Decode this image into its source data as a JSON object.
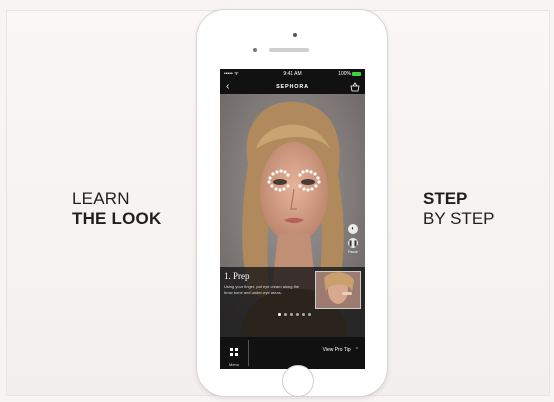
{
  "left_caption": {
    "line1": "LEARN",
    "line2": "THE LOOK"
  },
  "right_caption": {
    "line1": "STEP",
    "line2": "BY STEP"
  },
  "status_bar": {
    "carrier": "•••••  ᯤ",
    "time": "9:41 AM",
    "battery": "100%"
  },
  "nav": {
    "back_icon": "chevron-left-icon",
    "brand": "SEPHORA",
    "basket_icon": "basket-icon"
  },
  "controls": {
    "pause_label": "Pause"
  },
  "tip": {
    "title": "1. Prep",
    "text": "Using your finger, pat eye cream along the brow bone and under-eye areas.",
    "steps_total": 6,
    "active_step": 1
  },
  "bottom": {
    "menu_label": "Menu",
    "view_pro_tip": "View Pro Tip"
  },
  "colors": {
    "battery": "#3fd33f",
    "panel": "#141414",
    "eye_dots": "#ffffff"
  }
}
